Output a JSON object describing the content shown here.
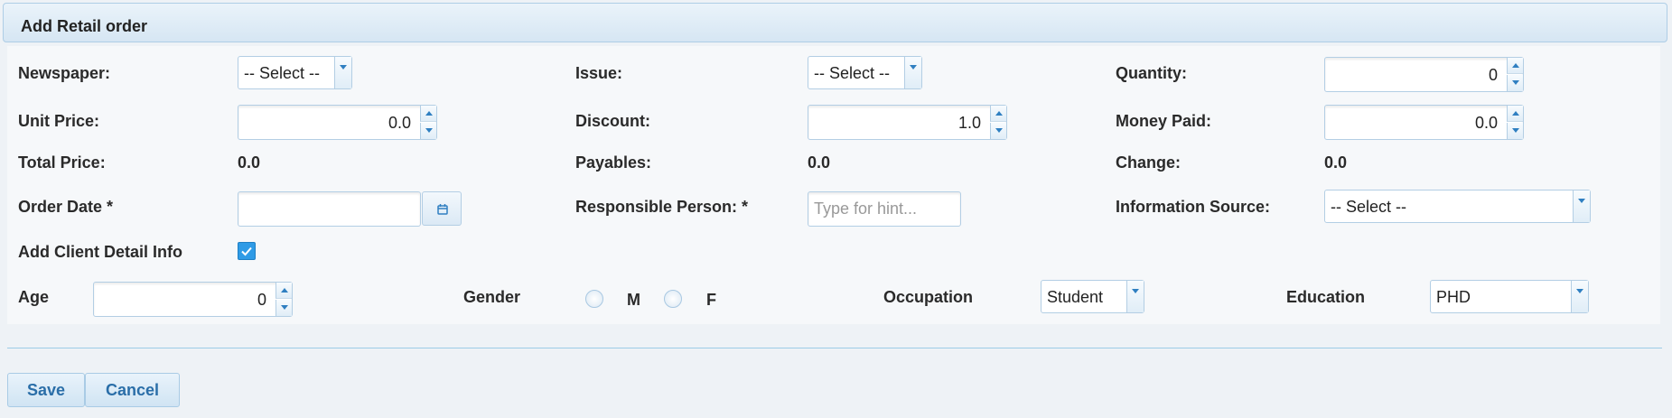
{
  "header": {
    "title": "Add Retail order"
  },
  "row1": {
    "newspaper_label": "Newspaper:",
    "newspaper_value": "-- Select --",
    "issue_label": "Issue:",
    "issue_value": "-- Select --",
    "quantity_label": "Quantity:",
    "quantity_value": "0"
  },
  "row2": {
    "unit_price_label": "Unit Price:",
    "unit_price_value": "0.0",
    "discount_label": "Discount:",
    "discount_value": "1.0",
    "money_paid_label": "Money Paid:",
    "money_paid_value": "0.0"
  },
  "row3": {
    "total_price_label": "Total Price:",
    "total_price_value": "0.0",
    "payables_label": "Payables:",
    "payables_value": "0.0",
    "change_label": "Change:",
    "change_value": "0.0"
  },
  "row4": {
    "order_date_label": "Order Date  *",
    "order_date_value": "",
    "responsible_label": "Responsible Person:  *",
    "responsible_placeholder": "Type for hint...",
    "info_source_label": "Information Source:",
    "info_source_value": "-- Select --"
  },
  "row5": {
    "client_detail_label": "Add Client Detail Info",
    "client_detail_checked": true
  },
  "row6": {
    "age_label": "Age",
    "age_value": "0",
    "gender_label": "Gender",
    "gender_m": "M",
    "gender_f": "F",
    "occupation_label": "Occupation",
    "occupation_value": "Student",
    "education_label": "Education",
    "education_value": "PHD"
  },
  "actions": {
    "save_label": "Save",
    "cancel_label": "Cancel"
  },
  "colors": {
    "accent": "#2f9be6",
    "border": "#b3cee4",
    "button_text": "#2a6ea8"
  },
  "icons": {
    "calendar": "calendar-icon",
    "check": "check-icon"
  }
}
